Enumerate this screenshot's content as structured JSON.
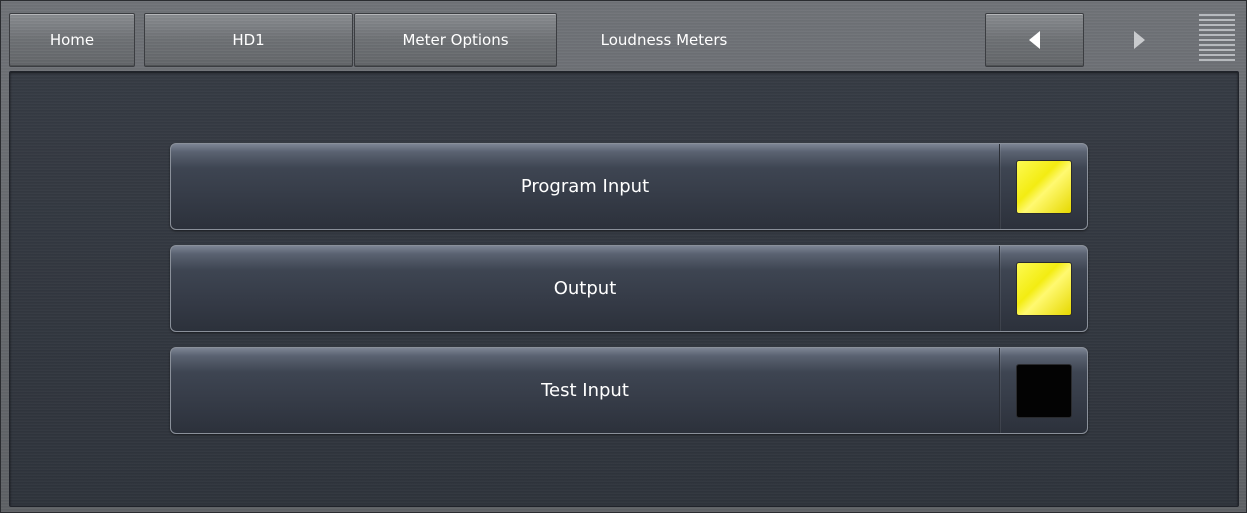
{
  "nav": {
    "home_label": "Home",
    "hd1_label": "HD1",
    "meter_options_label": "Meter Options",
    "current_page_label": "Loudness Meters",
    "back_icon": "chevron-left-icon",
    "forward_icon": "chevron-right-icon",
    "menu_icon": "menu-lines-icon"
  },
  "meters": [
    {
      "label": "Program Input",
      "state": "on",
      "indicator_color": "#f3ec12"
    },
    {
      "label": "Output",
      "state": "on",
      "indicator_color": "#f3ec12"
    },
    {
      "label": "Test Input",
      "state": "off",
      "indicator_color": "#030303"
    }
  ]
}
